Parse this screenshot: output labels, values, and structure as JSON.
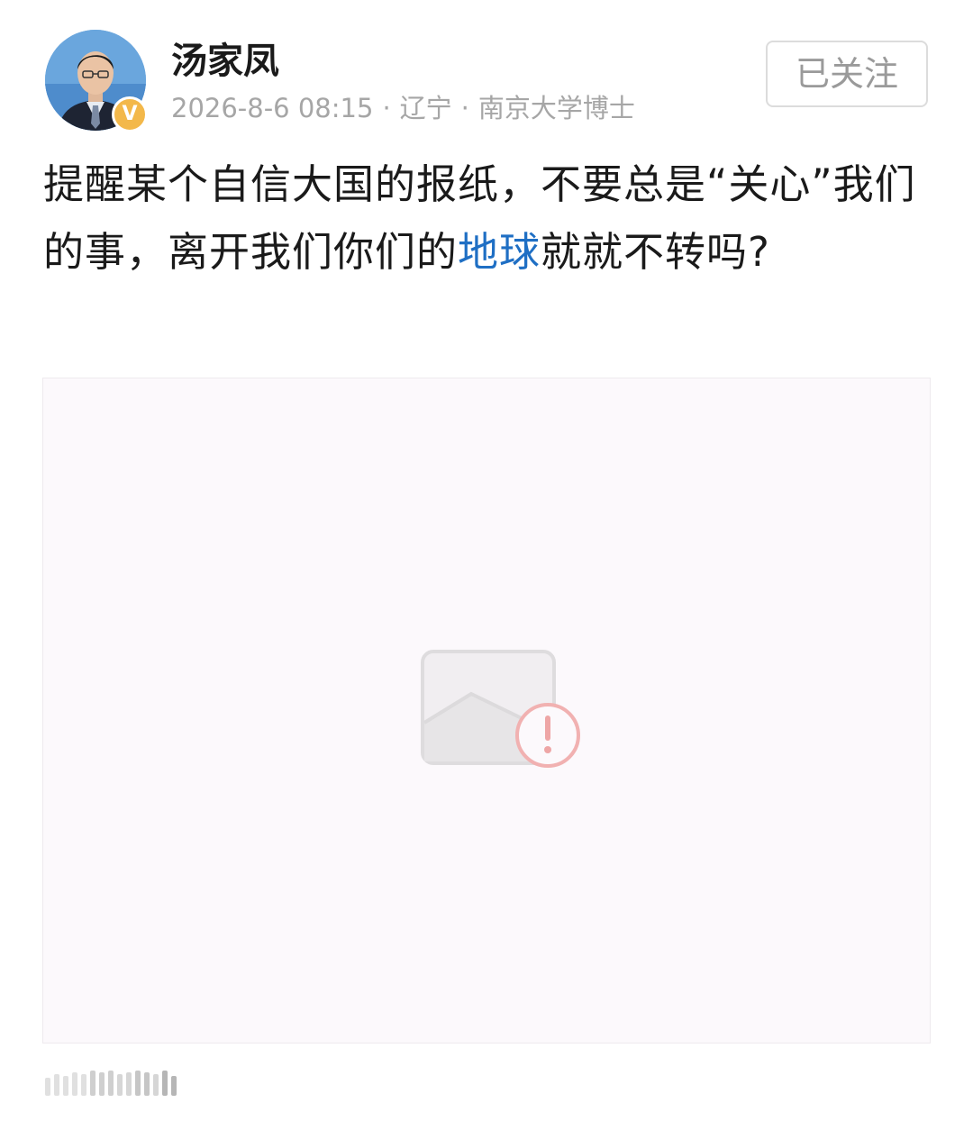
{
  "author": {
    "name": "汤家凤",
    "verified_badge": "V"
  },
  "meta": {
    "time": "2026-8-6 08:15",
    "location": "辽宁",
    "title": "南京大学博士",
    "separator": "·"
  },
  "follow_button": {
    "label": "已关注"
  },
  "post": {
    "text_before": "提醒某个自信大国的报纸，不要总是“关心”我们的事，离开我们你们的",
    "topic": "地球",
    "text_after": "就就不转吗?"
  },
  "image": {
    "state": "broken-image-icon"
  },
  "colors": {
    "topic_link": "#1f6fc4",
    "badge": "#f3b84a",
    "meta_gray": "#a6a6a6"
  }
}
